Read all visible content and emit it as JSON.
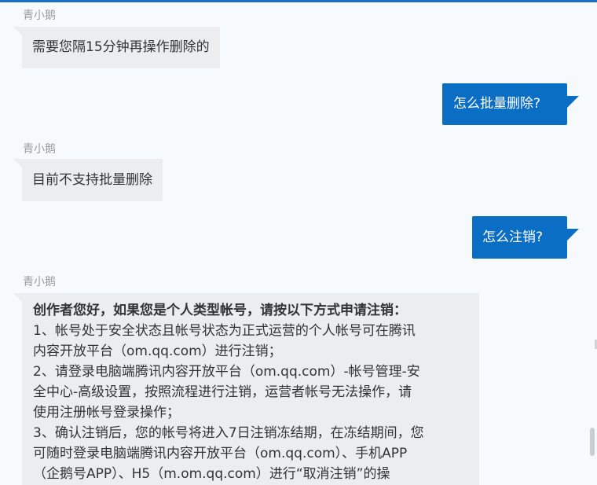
{
  "messages": [
    {
      "sender": "青小鹅",
      "text": "需要您隔15分钟再操作删除的"
    },
    {
      "text": "怎么批量删除?"
    },
    {
      "sender": "青小鹅",
      "text": "目前不支持批量删除"
    },
    {
      "text": "怎么注销?"
    },
    {
      "sender": "青小鹅",
      "lines": [
        "创作者您好，如果您是个人类型帐号，请按以下方式申请注销：",
        "1、帐号处于安全状态且帐号状态为正式运营的个人帐号可在腾讯",
        "内容开放平台（om.qq.com）进行注销；",
        "2、请登录电脑端腾讯内容开放平台（om.qq.com）-帐号管理-安",
        "全中心-高级设置，按照流程进行注销，运营者帐号无法操作，请",
        "使用注册帐号登录操作；",
        "3、确认注销后，您的帐号将进入7日注销冻结期，在冻结期间，您",
        "可随时登录电脑端腾讯内容开放平台（om.qq.com）、手机APP",
        "（企鹅号APP）、H5（m.om.qq.com）进行“取消注销”的操"
      ]
    }
  ],
  "colors": {
    "accent": "#1a6fc2",
    "user_bubble": "#0a6ec5",
    "bot_bubble": "#ebedef",
    "background": "#f7fafd"
  }
}
